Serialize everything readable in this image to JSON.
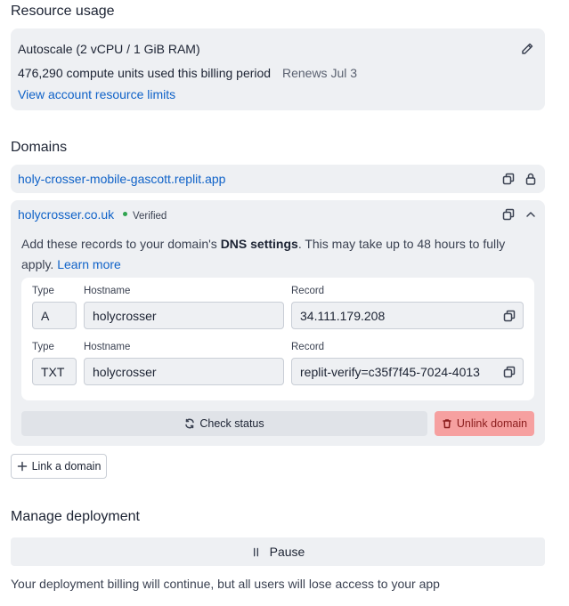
{
  "resource_usage": {
    "title": "Resource usage",
    "plan": "Autoscale (2 vCPU / 1 GiB RAM)",
    "usage": "476,290 compute units used this billing period",
    "renews": "Renews Jul 3",
    "limits_link": "View account resource limits"
  },
  "domains": {
    "title": "Domains",
    "replit_domain": "holy-crosser-mobile-gascott.replit.app",
    "custom_domain": {
      "name": "holycrosser.co.uk",
      "status": "Verified",
      "instructions_prefix": "Add these records to your domain's ",
      "instructions_bold": "DNS settings",
      "instructions_suffix": ". This may take up to 48 hours to fully",
      "instructions_line2": "apply. ",
      "learn_more": "Learn more",
      "records": [
        {
          "type_label": "Type",
          "hostname_label": "Hostname",
          "record_label": "Record",
          "type": "A",
          "hostname": "holycrosser",
          "record": "34.111.179.208"
        },
        {
          "type_label": "Type",
          "hostname_label": "Hostname",
          "record_label": "Record",
          "type": "TXT",
          "hostname": "holycrosser",
          "record": "replit-verify=c35f7f45-7024-4013"
        }
      ],
      "check_status": "Check status",
      "unlink": "Unlink domain"
    },
    "link_domain": "Link a domain"
  },
  "manage": {
    "title": "Manage deployment",
    "pause": "Pause",
    "note": "Your deployment billing will continue, but all users will lose access to your app"
  },
  "colors": {
    "card_bg": "#eef0f3",
    "link": "#0f62c8",
    "verified_dot": "#2fa44f",
    "unlink_bg": "#f6a0a0",
    "unlink_text": "#8a1c1c"
  }
}
